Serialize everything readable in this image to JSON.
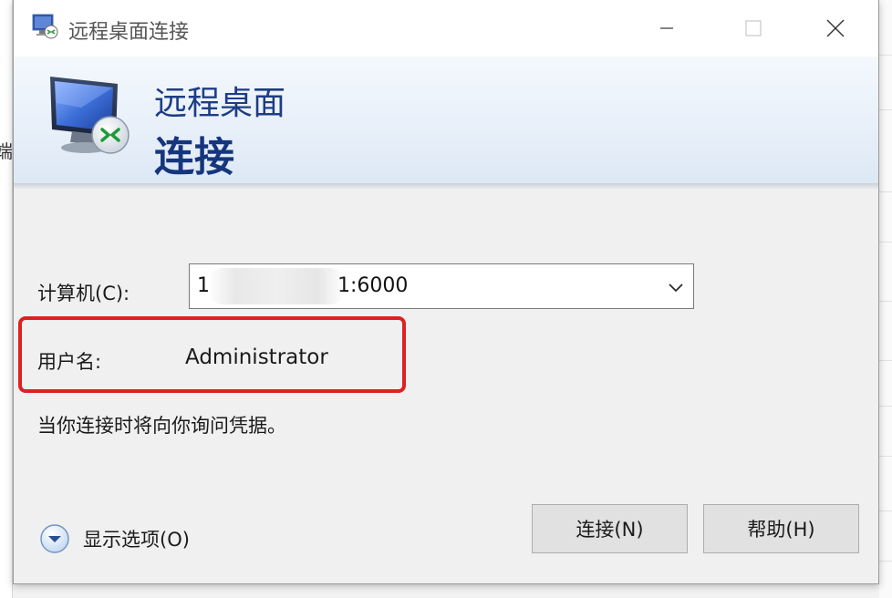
{
  "window": {
    "title": "远程桌面连接"
  },
  "background": {
    "left_text": "端"
  },
  "banner": {
    "title_line1": "远程桌面",
    "title_line2": "连接"
  },
  "form": {
    "computer_label": "计算机(C):",
    "computer_value_prefix": "1",
    "computer_value_suffix": "1:6000",
    "username_label": "用户名:",
    "username_value": "Administrator",
    "hint": "当你连接时将向你询问凭据。"
  },
  "footer": {
    "options_label": "显示选项(O)",
    "connect_button": "连接(N)",
    "help_button": "帮助(H)"
  },
  "colors": {
    "highlight": "#e02020",
    "banner_title": "#1d3d85"
  }
}
